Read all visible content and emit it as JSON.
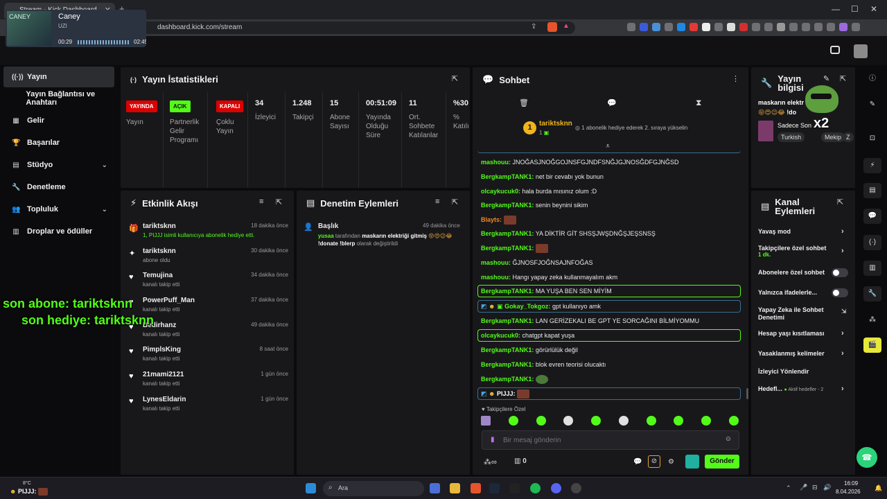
{
  "browser": {
    "tab_title": "Stream - Kick Dashboard",
    "url": "dashboard.kick.com/stream",
    "media": {
      "title": "Caney",
      "artist": "UZI",
      "elapsed": "00:29",
      "duration": "02:45",
      "thumb_text": "CANEY"
    }
  },
  "sidebar": {
    "items": [
      {
        "label": "Yayın",
        "icon": "broadcast-icon"
      },
      {
        "label": "Yayın Bağlantısı ve Anahtarı",
        "icon": ""
      },
      {
        "label": "Gelir",
        "icon": "revenue-icon"
      },
      {
        "label": "Başarılar",
        "icon": "trophy-icon"
      },
      {
        "label": "Stüdyo",
        "icon": "studio-icon"
      },
      {
        "label": "Denetleme",
        "icon": "wrench-icon"
      },
      {
        "label": "Topluluk",
        "icon": "community-icon"
      },
      {
        "label": "Droplar ve ödüller",
        "icon": "drops-icon"
      }
    ]
  },
  "stats": {
    "title": "Yayın İstatistikleri",
    "cols": [
      {
        "badge": "YAYINDA",
        "label": "Yayın"
      },
      {
        "badge": "AÇIK",
        "label": "Partnerlik Gelir Programı"
      },
      {
        "badge": "KAPALI",
        "label": "Çoklu Yayın"
      },
      {
        "value": "34",
        "label": "İzleyici"
      },
      {
        "value": "1.248",
        "label": "Takipçi"
      },
      {
        "value": "15",
        "label": "Abone Sayısı"
      },
      {
        "value": "00:51:09",
        "label": "Yayında Olduğu Süre"
      },
      {
        "value": "11",
        "label": "Ort. Sohbete Katılanlar"
      },
      {
        "value": "%30",
        "label": "% Katılı"
      }
    ]
  },
  "activity": {
    "title": "Etkinlik Akışı",
    "items": [
      {
        "name": "tariktsknn",
        "desc": "1, PIJJJ isimli kullanıcıya abonelik hediye etti.",
        "time": "18 dakika önce",
        "icon": "gift-icon"
      },
      {
        "name": "tariktsknn",
        "desc": "abone oldu",
        "time": "30 dakika önce",
        "icon": "sparkle-icon"
      },
      {
        "name": "Temujina",
        "desc": "kanalı takip etti",
        "time": "34 dakika önce",
        "icon": "heart-icon"
      },
      {
        "name": "PowerPuff_Man",
        "desc": "kanalı takip etti",
        "time": "37 dakika önce",
        "icon": "heart-icon"
      },
      {
        "name": "Bedirhanz",
        "desc": "kanalı takip etti",
        "time": "49 dakika önce",
        "icon": "heart-icon"
      },
      {
        "name": "PimplsKing",
        "desc": "kanalı takip etti",
        "time": "8 saat önce",
        "icon": "heart-icon"
      },
      {
        "name": "21mami2121",
        "desc": "kanalı takip etti",
        "time": "1 gün önce",
        "icon": "heart-icon"
      },
      {
        "name": "LynesEldarin",
        "desc": "kanalı takip etti",
        "time": "1 gün önce",
        "icon": "heart-icon"
      }
    ]
  },
  "moderation": {
    "title": "Denetim Eylemleri",
    "item": {
      "name": "Başlık",
      "time": "49 dakika önce",
      "user": "yusaa",
      "mid": "tarafından",
      "target": "maskarın elektriği gitmiş",
      "end": "!donate !blerp",
      "tail": "olarak değiştirildi"
    }
  },
  "chat": {
    "title": "Sohbet",
    "pinned": {
      "user": "tariktsknn",
      "count": "1",
      "text": "1 abonelik hediye ederek 2. sıraya yükselin"
    },
    "messages": [
      {
        "user": "mashouu:",
        "text": "JNOĞASJNOĞGOJNSFGJNDFSNĞJGJNOSĞDFGJNĞSD"
      },
      {
        "user": "BergkampTANK1:",
        "text": "net bir cevabı yok bunun"
      },
      {
        "user": "olcaykucuk0:",
        "text": "hala burda mısınız olum :D"
      },
      {
        "user": "BergkampTANK1:",
        "text": "senin beynini sikim"
      },
      {
        "user": "Blayts:",
        "text": ""
      },
      {
        "user": "BergkampTANK1:",
        "text": "YA DİKTİR GİT SHSŞJWŞDNĞŞJEŞSNSŞ"
      },
      {
        "user": "BergkampTANK1:",
        "text": ""
      },
      {
        "user": "mashouu:",
        "text": "ĞJNOSFJOĞNSAJNFOĞAS"
      },
      {
        "user": "mashouu:",
        "text": "Hangı yapay zeka kullanmayalım akm"
      },
      {
        "user": "BergkampTANK1:",
        "text": "MA YUŞA BEN SEN MİYİM"
      },
      {
        "user": "Gokay_Tokgoz:",
        "text": "gpt kullanıyo amk"
      },
      {
        "user": "BergkampTANK1:",
        "text": "LAN GERİZEKALI BE GPT YE SORCAĞINI BİLMİYOMMU"
      },
      {
        "user": "olcaykucuk0:",
        "text": "chatgpt kapat yuşa"
      },
      {
        "user": "BergkampTANK1:",
        "text": "görürlülük değil"
      },
      {
        "user": "BergkampTANK1:",
        "text": "blok evren teorisi olucaktı"
      },
      {
        "user": "BergkampTANK1:",
        "text": ""
      },
      {
        "user": "PIJJJ:",
        "text": ""
      }
    ],
    "followers_only": "Takipçilere Özel",
    "placeholder": "Bir mesaj gönderin",
    "points": "0",
    "send": "Gönder"
  },
  "info": {
    "title": "Yayın bilgisi",
    "stream_title": "maskarın elektr",
    "donate": "!do",
    "category": "Sadece Son",
    "tags": [
      "Turkish",
      "Mekip",
      "Z"
    ]
  },
  "channel": {
    "title": "Kanal Eylemleri",
    "items": [
      {
        "label": "Yavaş mod",
        "sub": ""
      },
      {
        "label": "Takipçilere özel sohbet",
        "sub": "1 dk."
      },
      {
        "label": "Abonelere özel sohbet",
        "sub": ""
      },
      {
        "label": "Yalnızca ifadelerle...",
        "sub": ""
      },
      {
        "label": "Yapay Zeka ile Sohbet Denetimi",
        "sub": ""
      },
      {
        "label": "Hesap yaşı kısıtlaması",
        "sub": ""
      },
      {
        "label": "Yasaklanmış kelimeler",
        "sub": ""
      },
      {
        "label": "İzleyici Yönlendir",
        "sub": ""
      },
      {
        "label": "Hedefl...",
        "sub": "Aktif hedefler - 2"
      }
    ]
  },
  "overlay": {
    "line1": "son abone: tariktsknn",
    "line2": "son hediye: tariktsknn",
    "x2": "x2"
  },
  "taskbar": {
    "weather": "8°C",
    "user": "PIJJJ:",
    "search": "Ara",
    "time": "16:09",
    "date": "8.04.2026"
  }
}
